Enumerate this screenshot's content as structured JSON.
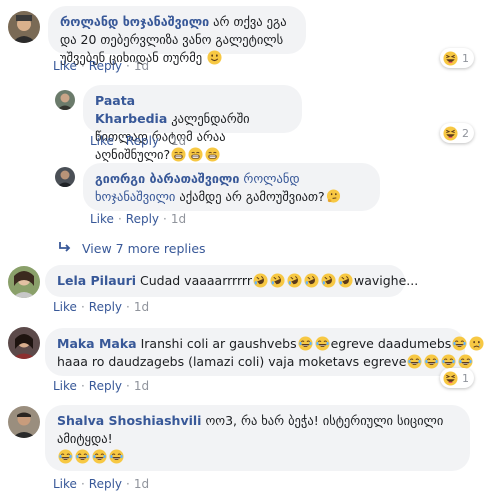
{
  "comments": [
    {
      "author": "როლანდ ხოჯანაშვილი",
      "text": "არ თქვა ეგა და 20 თებერვლიზა ვანო გალეტილს უშვებენ ციხიდან თურმე",
      "emoji": "smile",
      "actions": {
        "like": "Like",
        "reply": "Reply",
        "time": "1d"
      },
      "reaction": {
        "icon": "haha",
        "count": "1"
      }
    },
    {
      "author": "Paata Kharbedia",
      "text": "კალენდარში წითლად რატომ არაა აღნიშნული?",
      "actions": {
        "like": "Like",
        "reply": "Reply",
        "time": "1d"
      },
      "reaction": {
        "icon": "haha",
        "count": "2"
      }
    },
    {
      "author": "გიორგი ბარათაშვილი",
      "mention": "როლანდ ხოჯანაშვილი",
      "text": "აქამდე არ გამოუშვიათ?",
      "actions": {
        "like": "Like",
        "reply": "Reply",
        "time": "1d"
      }
    },
    {
      "author": "Lela Pilauri",
      "text_before": "Cudad vaaaarrrrrr",
      "text_after": "wavighe...",
      "actions": {
        "like": "Like",
        "reply": "Reply",
        "time": "1d"
      }
    },
    {
      "author": "Maka Maka",
      "line1": "Iranshi coli ar gaushvebs",
      "line1b": "egreve daadumebs",
      "line2": "haaa ro daudzagebs (lamazi coli) vaja moketavs egreve",
      "actions": {
        "like": "Like",
        "reply": "Reply",
        "time": "1d"
      },
      "reaction": {
        "icon": "haha",
        "count": "1"
      }
    },
    {
      "author": "Shalva Shoshiashvili",
      "text": "ოო3, რა ხარ ბეჭა! ისტერიული სიცილი ამიტყდა!",
      "actions": {
        "like": "Like",
        "reply": "Reply",
        "time": "1d"
      }
    }
  ],
  "view_more": "View 7 more replies",
  "colors": {
    "link": "#385898",
    "bubble": "#f2f3f5",
    "meta": "#90949c",
    "emoji": "#f7c843"
  }
}
